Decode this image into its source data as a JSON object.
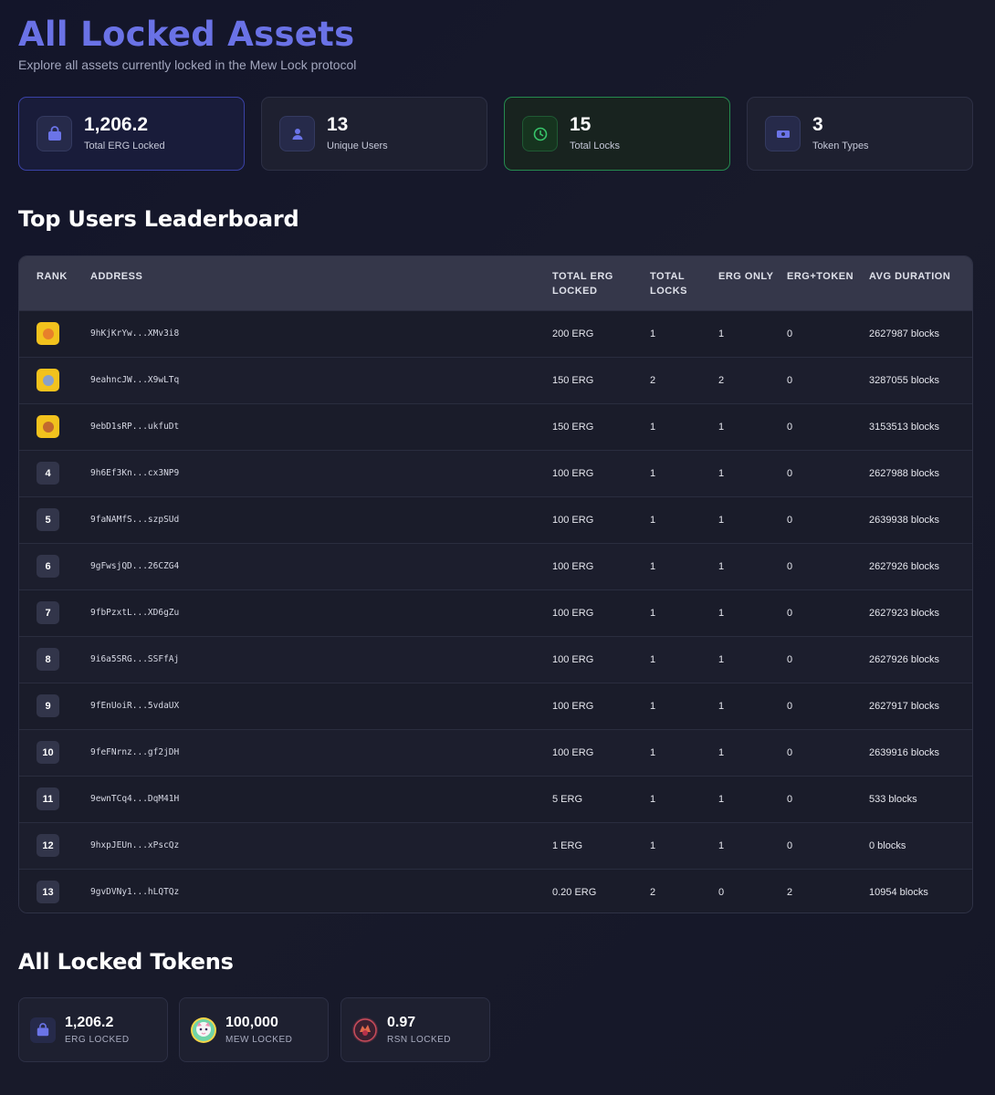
{
  "header": {
    "title": "All Locked Assets",
    "subtitle": "Explore all assets currently locked in the Mew Lock protocol"
  },
  "stats": [
    {
      "value": "1,206.2",
      "label": "Total ERG Locked",
      "icon": "lock-icon"
    },
    {
      "value": "13",
      "label": "Unique Users",
      "icon": "user-icon"
    },
    {
      "value": "15",
      "label": "Total Locks",
      "icon": "clock-icon"
    },
    {
      "value": "3",
      "label": "Token Types",
      "icon": "money-icon"
    }
  ],
  "leaderboard": {
    "title": "Top Users Leaderboard",
    "columns": [
      "RANK",
      "ADDRESS",
      "TOTAL ERG LOCKED",
      "TOTAL LOCKS",
      "ERG ONLY",
      "ERG+TOKEN",
      "AVG DURATION"
    ],
    "rows": [
      {
        "rank": "1",
        "medal": "crown-icon",
        "address": "9hKjKrYw...XMv3i8",
        "total_erg": "200 ERG",
        "total_locks": "1",
        "erg_only": "1",
        "erg_token": "0",
        "avg_duration": "2627987 blocks"
      },
      {
        "rank": "2",
        "medal": "silver-medal-icon",
        "address": "9eahncJW...X9wLTq",
        "total_erg": "150 ERG",
        "total_locks": "2",
        "erg_only": "2",
        "erg_token": "0",
        "avg_duration": "3287055 blocks"
      },
      {
        "rank": "3",
        "medal": "bronze-medal-icon",
        "address": "9ebD1sRP...ukfuDt",
        "total_erg": "150 ERG",
        "total_locks": "1",
        "erg_only": "1",
        "erg_token": "0",
        "avg_duration": "3153513 blocks"
      },
      {
        "rank": "4",
        "address": "9h6Ef3Kn...cx3NP9",
        "total_erg": "100 ERG",
        "total_locks": "1",
        "erg_only": "1",
        "erg_token": "0",
        "avg_duration": "2627988 blocks"
      },
      {
        "rank": "5",
        "address": "9faNAMfS...szpSUd",
        "total_erg": "100 ERG",
        "total_locks": "1",
        "erg_only": "1",
        "erg_token": "0",
        "avg_duration": "2639938 blocks"
      },
      {
        "rank": "6",
        "address": "9gFwsjQD...26CZG4",
        "total_erg": "100 ERG",
        "total_locks": "1",
        "erg_only": "1",
        "erg_token": "0",
        "avg_duration": "2627926 blocks"
      },
      {
        "rank": "7",
        "address": "9fbPzxtL...XD6gZu",
        "total_erg": "100 ERG",
        "total_locks": "1",
        "erg_only": "1",
        "erg_token": "0",
        "avg_duration": "2627923 blocks"
      },
      {
        "rank": "8",
        "address": "9i6a5SRG...SSFfAj",
        "total_erg": "100 ERG",
        "total_locks": "1",
        "erg_only": "1",
        "erg_token": "0",
        "avg_duration": "2627926 blocks"
      },
      {
        "rank": "9",
        "address": "9fEnUoiR...5vdaUX",
        "total_erg": "100 ERG",
        "total_locks": "1",
        "erg_only": "1",
        "erg_token": "0",
        "avg_duration": "2627917 blocks"
      },
      {
        "rank": "10",
        "address": "9feFNrnz...gf2jDH",
        "total_erg": "100 ERG",
        "total_locks": "1",
        "erg_only": "1",
        "erg_token": "0",
        "avg_duration": "2639916 blocks"
      },
      {
        "rank": "11",
        "address": "9ewnTCq4...DqM41H",
        "total_erg": "5 ERG",
        "total_locks": "1",
        "erg_only": "1",
        "erg_token": "0",
        "avg_duration": "533 blocks"
      },
      {
        "rank": "12",
        "address": "9hxpJEUn...xPscQz",
        "total_erg": "1 ERG",
        "total_locks": "1",
        "erg_only": "1",
        "erg_token": "0",
        "avg_duration": "0 blocks"
      },
      {
        "rank": "13",
        "address": "9gvDVNy1...hLQTQz",
        "total_erg": "0.20 ERG",
        "total_locks": "2",
        "erg_only": "0",
        "erg_token": "2",
        "avg_duration": "10954 blocks"
      }
    ]
  },
  "tokens": {
    "title": "All Locked Tokens",
    "items": [
      {
        "value": "1,206.2",
        "label": "ERG LOCKED",
        "icon": "lock-icon"
      },
      {
        "value": "100,000",
        "label": "MEW LOCKED",
        "icon": "mew-token-icon"
      },
      {
        "value": "0.97",
        "label": "RSN LOCKED",
        "icon": "rsn-token-icon"
      }
    ]
  },
  "colors": {
    "accent": "#6a72e6",
    "gold": "#f2c21d",
    "green": "#258a4f",
    "background": "#13152a"
  }
}
